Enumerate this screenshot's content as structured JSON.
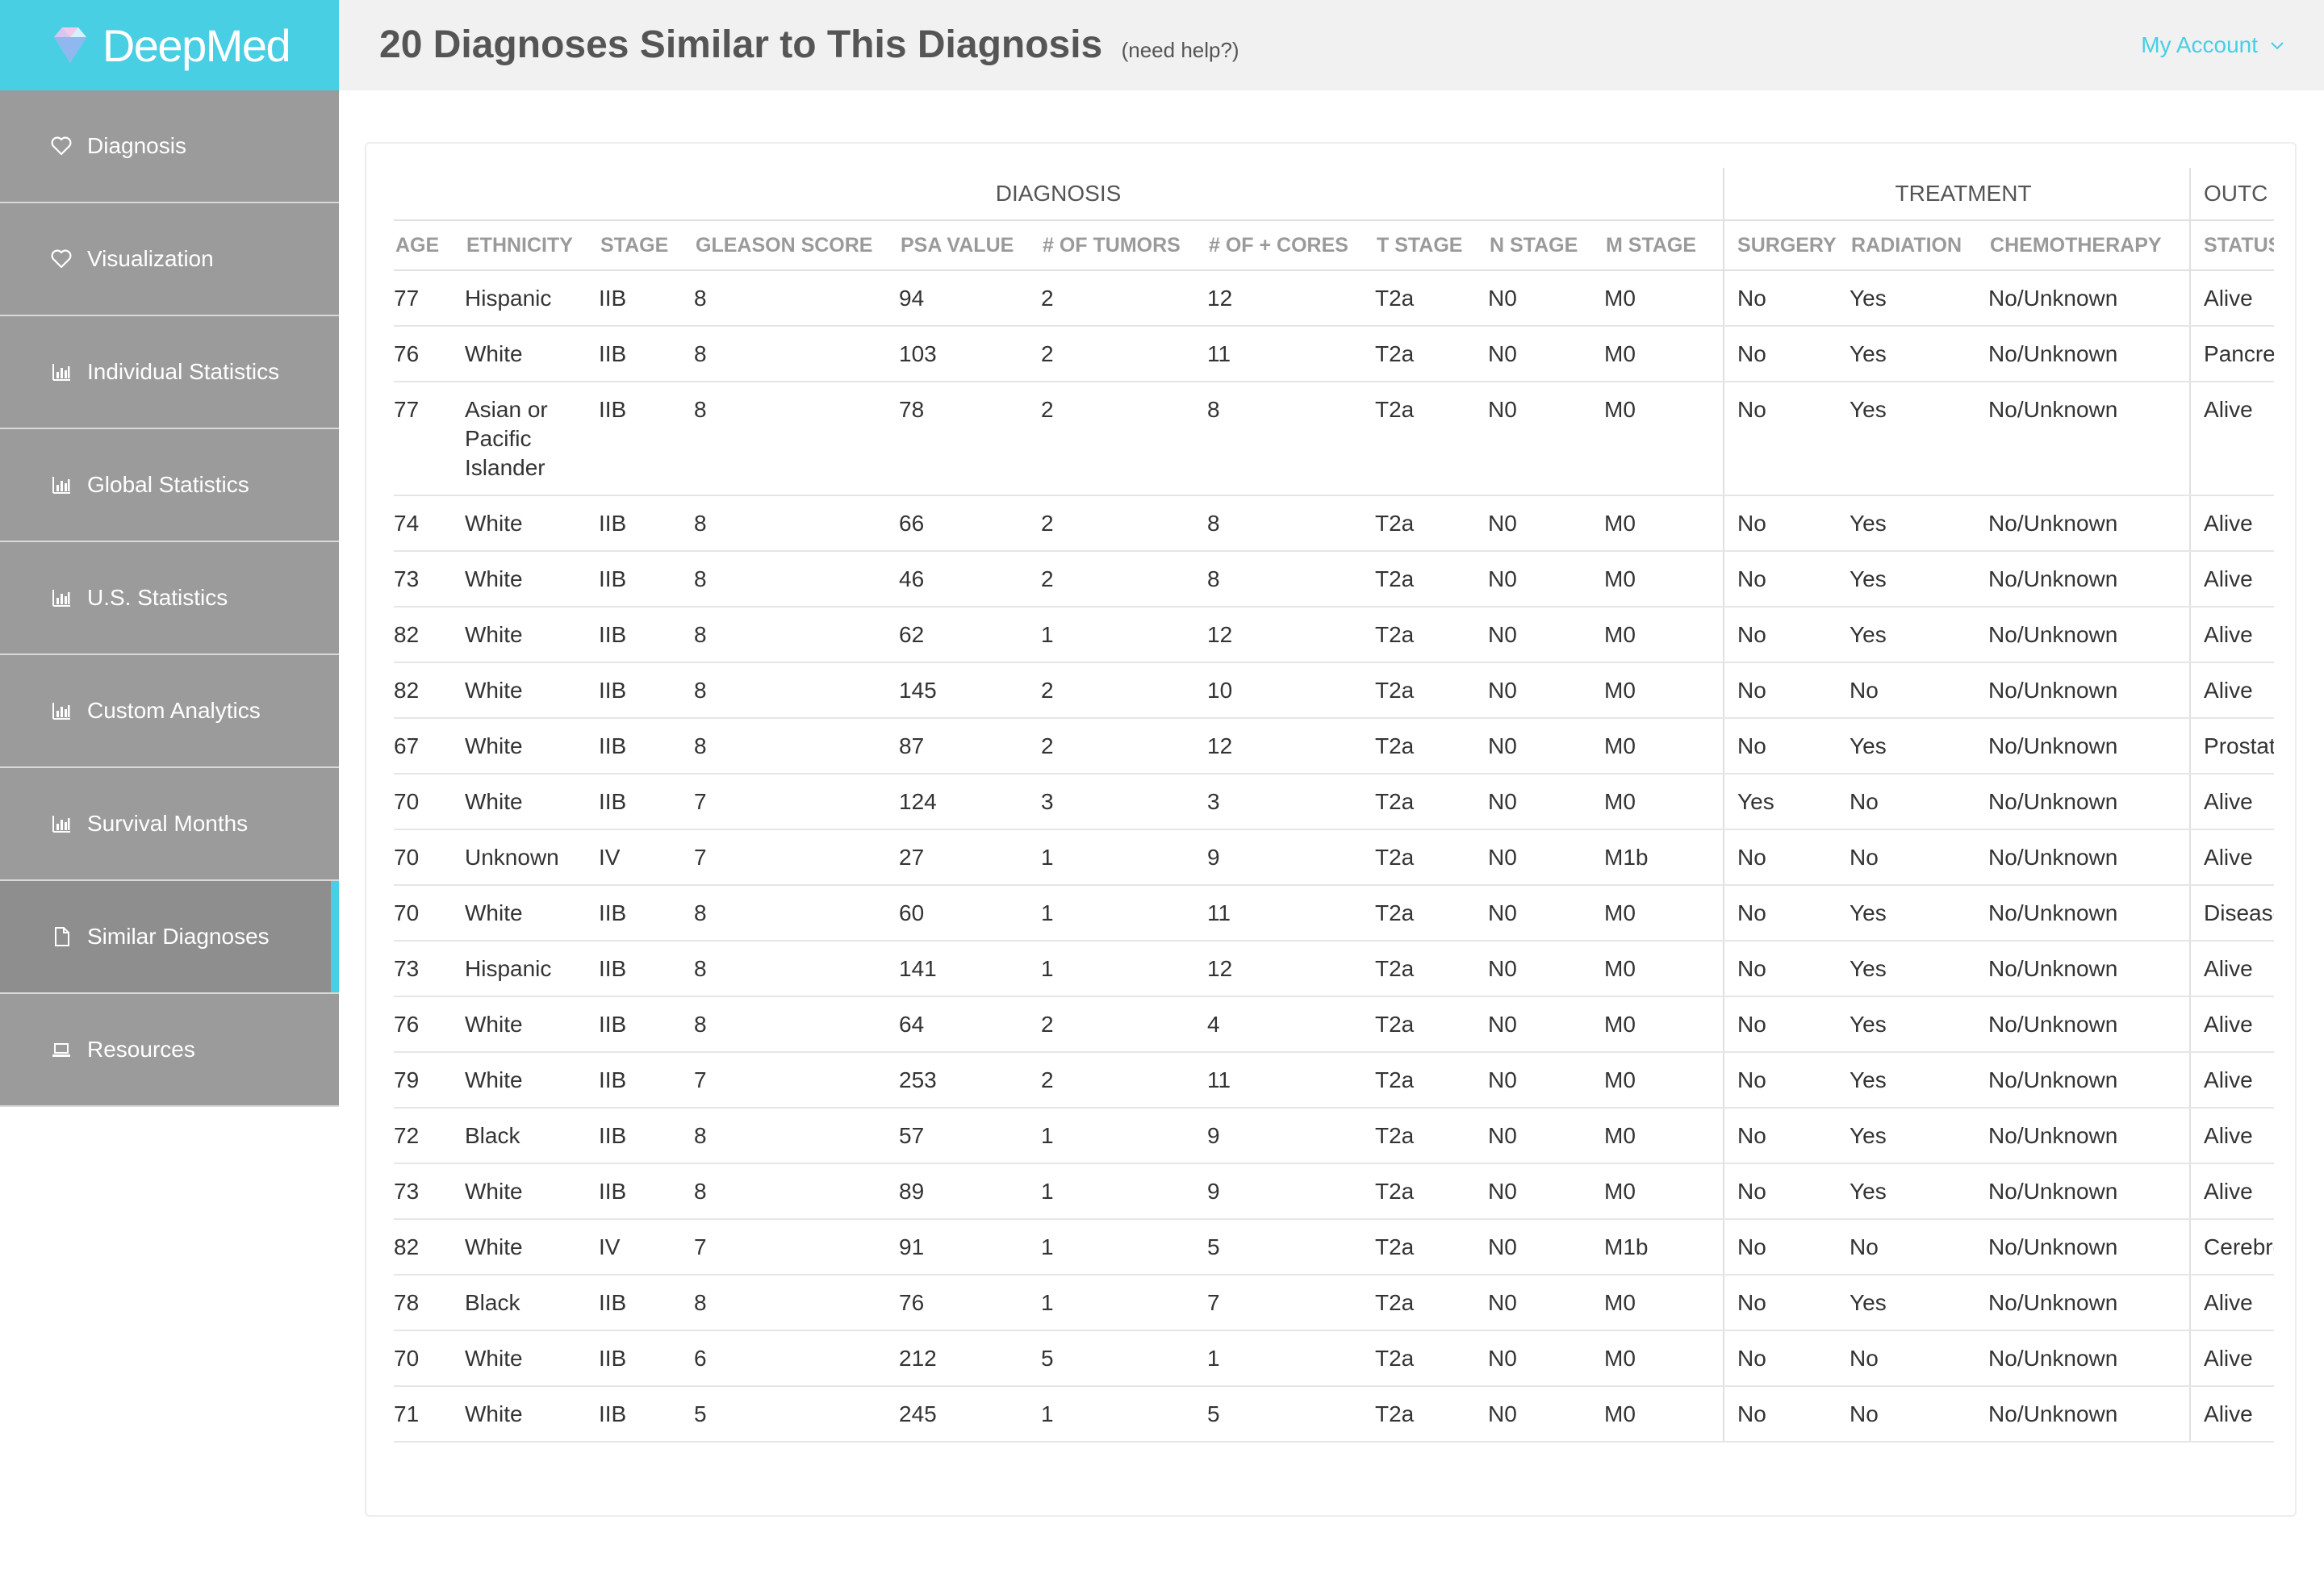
{
  "brand": {
    "name": "DeepMed",
    "accent": "#48cfe3"
  },
  "header": {
    "title": "20 Diagnoses Similar to This Diagnosis",
    "help": "(need help?)",
    "account": "My Account"
  },
  "sidebar": {
    "items": [
      {
        "label": "Diagnosis",
        "icon": "heart-icon"
      },
      {
        "label": "Visualization",
        "icon": "heart-icon"
      },
      {
        "label": "Individual Statistics",
        "icon": "bar-chart-icon"
      },
      {
        "label": "Global Statistics",
        "icon": "bar-chart-icon"
      },
      {
        "label": "U.S. Statistics",
        "icon": "bar-chart-icon"
      },
      {
        "label": "Custom Analytics",
        "icon": "bar-chart-icon"
      },
      {
        "label": "Survival Months",
        "icon": "bar-chart-icon"
      },
      {
        "label": "Similar Diagnoses",
        "icon": "document-icon",
        "active": true
      },
      {
        "label": "Resources",
        "icon": "laptop-icon"
      }
    ]
  },
  "table": {
    "groups": [
      "DIAGNOSIS",
      "TREATMENT",
      "OUTC"
    ],
    "columns": [
      "AGE",
      "ETHNICITY",
      "STAGE",
      "GLEASON SCORE",
      "PSA VALUE",
      "# OF TUMORS",
      "# OF + CORES",
      "T STAGE",
      "N STAGE",
      "M STAGE",
      "SURGERY",
      "RADIATION",
      "CHEMOTHERAPY",
      "STATUS"
    ],
    "rows": [
      [
        "77",
        "Hispanic",
        "IIB",
        "8",
        "94",
        "2",
        "12",
        "T2a",
        "N0",
        "M0",
        "No",
        "Yes",
        "No/Unknown",
        "Alive"
      ],
      [
        "76",
        "White",
        "IIB",
        "8",
        "103",
        "2",
        "11",
        "T2a",
        "N0",
        "M0",
        "No",
        "Yes",
        "No/Unknown",
        "Pancrea"
      ],
      [
        "77",
        "Asian or Pacific Islander",
        "IIB",
        "8",
        "78",
        "2",
        "8",
        "T2a",
        "N0",
        "M0",
        "No",
        "Yes",
        "No/Unknown",
        "Alive"
      ],
      [
        "74",
        "White",
        "IIB",
        "8",
        "66",
        "2",
        "8",
        "T2a",
        "N0",
        "M0",
        "No",
        "Yes",
        "No/Unknown",
        "Alive"
      ],
      [
        "73",
        "White",
        "IIB",
        "8",
        "46",
        "2",
        "8",
        "T2a",
        "N0",
        "M0",
        "No",
        "Yes",
        "No/Unknown",
        "Alive"
      ],
      [
        "82",
        "White",
        "IIB",
        "8",
        "62",
        "1",
        "12",
        "T2a",
        "N0",
        "M0",
        "No",
        "Yes",
        "No/Unknown",
        "Alive"
      ],
      [
        "82",
        "White",
        "IIB",
        "8",
        "145",
        "2",
        "10",
        "T2a",
        "N0",
        "M0",
        "No",
        "No",
        "No/Unknown",
        "Alive"
      ],
      [
        "67",
        "White",
        "IIB",
        "8",
        "87",
        "2",
        "12",
        "T2a",
        "N0",
        "M0",
        "No",
        "Yes",
        "No/Unknown",
        "Prostate"
      ],
      [
        "70",
        "White",
        "IIB",
        "7",
        "124",
        "3",
        "3",
        "T2a",
        "N0",
        "M0",
        "Yes",
        "No",
        "No/Unknown",
        "Alive"
      ],
      [
        "70",
        "Unknown",
        "IV",
        "7",
        "27",
        "1",
        "9",
        "T2a",
        "N0",
        "M1b",
        "No",
        "No",
        "No/Unknown",
        "Alive"
      ],
      [
        "70",
        "White",
        "IIB",
        "8",
        "60",
        "1",
        "11",
        "T2a",
        "N0",
        "M0",
        "No",
        "Yes",
        "No/Unknown",
        "Disease Heart"
      ],
      [
        "73",
        "Hispanic",
        "IIB",
        "8",
        "141",
        "1",
        "12",
        "T2a",
        "N0",
        "M0",
        "No",
        "Yes",
        "No/Unknown",
        "Alive"
      ],
      [
        "76",
        "White",
        "IIB",
        "8",
        "64",
        "2",
        "4",
        "T2a",
        "N0",
        "M0",
        "No",
        "Yes",
        "No/Unknown",
        "Alive"
      ],
      [
        "79",
        "White",
        "IIB",
        "7",
        "253",
        "2",
        "11",
        "T2a",
        "N0",
        "M0",
        "No",
        "Yes",
        "No/Unknown",
        "Alive"
      ],
      [
        "72",
        "Black",
        "IIB",
        "8",
        "57",
        "1",
        "9",
        "T2a",
        "N0",
        "M0",
        "No",
        "Yes",
        "No/Unknown",
        "Alive"
      ],
      [
        "73",
        "White",
        "IIB",
        "8",
        "89",
        "1",
        "9",
        "T2a",
        "N0",
        "M0",
        "No",
        "Yes",
        "No/Unknown",
        "Alive"
      ],
      [
        "82",
        "White",
        "IV",
        "7",
        "91",
        "1",
        "5",
        "T2a",
        "N0",
        "M1b",
        "No",
        "No",
        "No/Unknown",
        "Cerebro Disease"
      ],
      [
        "78",
        "Black",
        "IIB",
        "8",
        "76",
        "1",
        "7",
        "T2a",
        "N0",
        "M0",
        "No",
        "Yes",
        "No/Unknown",
        "Alive"
      ],
      [
        "70",
        "White",
        "IIB",
        "6",
        "212",
        "5",
        "1",
        "T2a",
        "N0",
        "M0",
        "No",
        "No",
        "No/Unknown",
        "Alive"
      ],
      [
        "71",
        "White",
        "IIB",
        "5",
        "245",
        "1",
        "5",
        "T2a",
        "N0",
        "M0",
        "No",
        "No",
        "No/Unknown",
        "Alive"
      ]
    ]
  }
}
